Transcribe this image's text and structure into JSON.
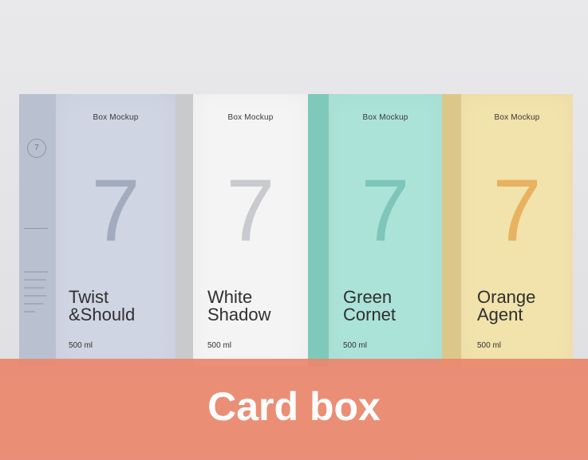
{
  "boxes": [
    {
      "brand": "Box Mockup",
      "number": "7",
      "name_line1": "Twist",
      "name_line2": "&Should",
      "volume": "500 ml",
      "color": "#cfd5e2",
      "side_color": "#b9c0d0",
      "number_color": "#a3abbe"
    },
    {
      "brand": "Box Mockup",
      "number": "7",
      "name_line1": "White",
      "name_line2": "Shadow",
      "volume": "500 ml",
      "color": "#f4f4f4",
      "side_color": "#c9cacc",
      "number_color": "#c9cacd"
    },
    {
      "brand": "Box Mockup",
      "number": "7",
      "name_line1": "Green",
      "name_line2": "Cornet",
      "volume": "500 ml",
      "color": "#ace3d8",
      "side_color": "#7fc9bb",
      "number_color": "#7dc6b9"
    },
    {
      "brand": "Box Mockup",
      "number": "7",
      "name_line1": "Orange",
      "name_line2": "Agent",
      "volume": "500 ml",
      "color": "#f2e2ab",
      "side_color": "#dcc78a",
      "number_color": "#e8b260"
    }
  ],
  "side_emblem": "7",
  "banner": {
    "text": "Card box",
    "color": "#ec876c"
  }
}
